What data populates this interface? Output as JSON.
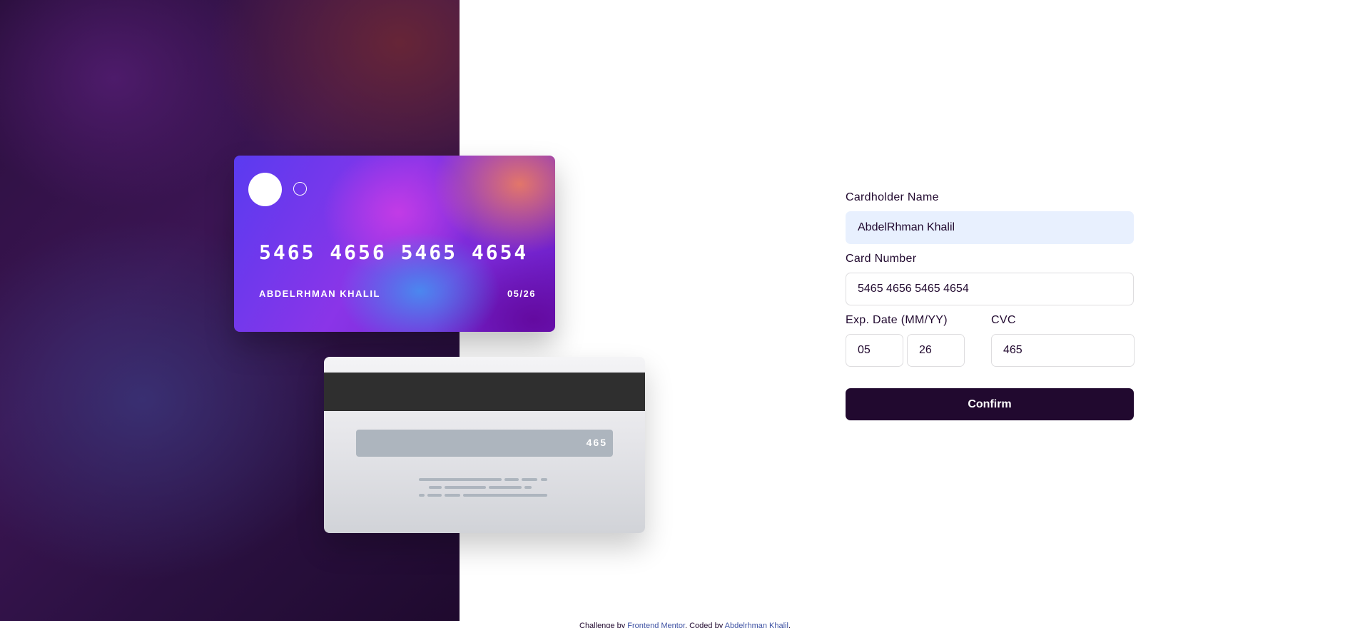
{
  "card_front": {
    "number": "5465 4656 5465 4654",
    "holder": "ABDELRHMAN KHALIL",
    "exp_month": "05",
    "exp_sep": "/",
    "exp_year": "26"
  },
  "card_back": {
    "cvc": "465"
  },
  "form": {
    "name_label": "Cardholder Name",
    "name_value": "AbdelRhman Khalil",
    "number_label": "Card Number",
    "number_value": "5465 4656 5465 4654",
    "exp_label": "Exp. Date (MM/YY)",
    "exp_month_value": "05",
    "exp_year_value": "26",
    "cvc_label": "CVC",
    "cvc_value": "465",
    "confirm_label": "Confirm"
  },
  "footer": {
    "prefix": "Challenge by ",
    "link1": "Frontend Mentor",
    "middle": ". Coded by ",
    "link2": "Abdelrhman Khalil",
    "suffix": "."
  },
  "colors": {
    "dark_violet": "#21092f",
    "autofill_bg": "#e8f0fe",
    "link": "#3e52a3"
  }
}
